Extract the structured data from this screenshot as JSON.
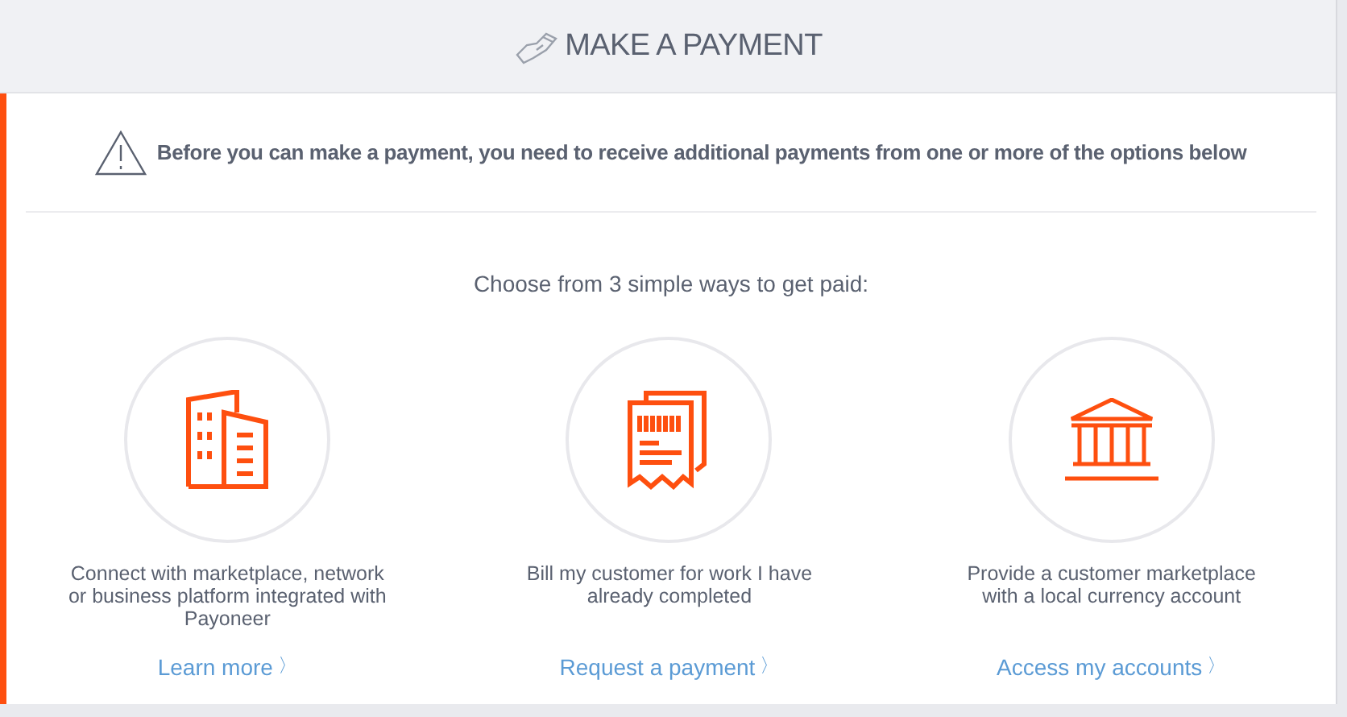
{
  "header": {
    "title": "MAKE A PAYMENT"
  },
  "warning": {
    "text": "Before you can make a payment, you need to receive additional payments from one or more of the options below"
  },
  "intro": "Choose from 3 simple ways to get paid:",
  "options": [
    {
      "kind": "buildings",
      "description": "Connect with marketplace, network or business platform integrated with Payoneer",
      "link": "Learn more",
      "chevron": "〉"
    },
    {
      "kind": "invoice",
      "description": "Bill my customer for work I have already completed",
      "link": "Request a payment",
      "chevron": "〉"
    },
    {
      "kind": "bank",
      "description": "Provide a customer marketplace with a local currency account",
      "link": "Access my accounts",
      "chevron": "〉"
    }
  ]
}
